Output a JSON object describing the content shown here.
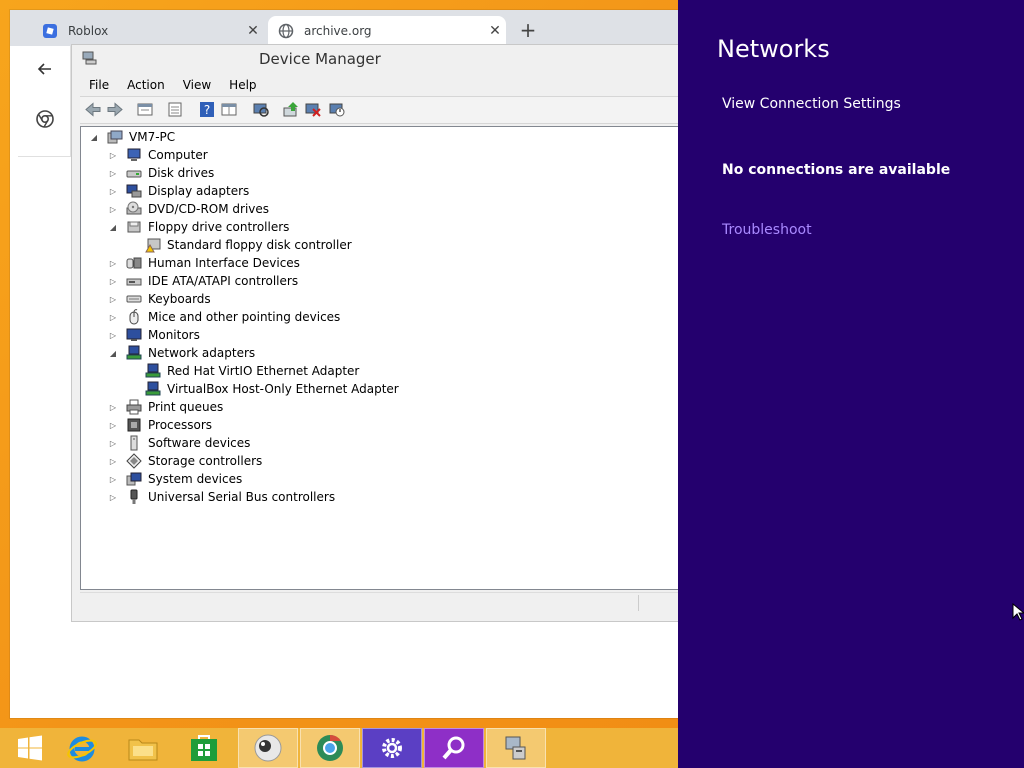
{
  "browser": {
    "tabs": [
      {
        "title": "Roblox",
        "favicon": "roblox-icon",
        "active": false
      },
      {
        "title": "archive.org",
        "favicon": "globe-icon",
        "active": true
      }
    ],
    "new_tab_symbol": "+",
    "close_symbol": "✕",
    "rail": [
      "back-arrow-icon",
      "chrome-icon"
    ]
  },
  "device_manager": {
    "title": "Device Manager",
    "menu": [
      "File",
      "Action",
      "View",
      "Help"
    ],
    "toolbar": [
      "back-icon",
      "forward-icon",
      "properties-icon",
      "show-hide-icon",
      "help-icon",
      "action-pane-icon",
      "scan-hardware-icon",
      "update-driver-icon",
      "uninstall-icon",
      "disable-icon"
    ],
    "tree": {
      "root": "VM7-PC",
      "nodes": [
        {
          "label": "Computer",
          "expanded": false,
          "icon": "computer-icon"
        },
        {
          "label": "Disk drives",
          "expanded": false,
          "icon": "disk-drive-icon"
        },
        {
          "label": "Display adapters",
          "expanded": false,
          "icon": "display-adapter-icon"
        },
        {
          "label": "DVD/CD-ROM drives",
          "expanded": false,
          "icon": "dvd-icon"
        },
        {
          "label": "Floppy drive controllers",
          "expanded": true,
          "icon": "floppy-controller-icon",
          "children": [
            {
              "label": "Standard floppy disk controller",
              "icon": "floppy-warning-icon"
            }
          ]
        },
        {
          "label": "Human Interface Devices",
          "expanded": false,
          "icon": "hid-icon"
        },
        {
          "label": "IDE ATA/ATAPI controllers",
          "expanded": false,
          "icon": "ide-icon"
        },
        {
          "label": "Keyboards",
          "expanded": false,
          "icon": "keyboard-icon"
        },
        {
          "label": "Mice and other pointing devices",
          "expanded": false,
          "icon": "mouse-icon"
        },
        {
          "label": "Monitors",
          "expanded": false,
          "icon": "monitor-icon"
        },
        {
          "label": "Network adapters",
          "expanded": true,
          "icon": "network-adapter-icon",
          "children": [
            {
              "label": "Red Hat VirtIO Ethernet Adapter",
              "icon": "network-adapter-icon"
            },
            {
              "label": "VirtualBox Host-Only Ethernet Adapter",
              "icon": "network-adapter-icon"
            }
          ]
        },
        {
          "label": "Print queues",
          "expanded": false,
          "icon": "printer-icon"
        },
        {
          "label": "Processors",
          "expanded": false,
          "icon": "processor-icon"
        },
        {
          "label": "Software devices",
          "expanded": false,
          "icon": "software-device-icon"
        },
        {
          "label": "Storage controllers",
          "expanded": false,
          "icon": "storage-controller-icon"
        },
        {
          "label": "System devices",
          "expanded": false,
          "icon": "system-device-icon"
        },
        {
          "label": "Universal Serial Bus controllers",
          "expanded": false,
          "icon": "usb-icon"
        }
      ]
    }
  },
  "networks_panel": {
    "title": "Networks",
    "view_settings": "View Connection Settings",
    "status": "No connections are available",
    "troubleshoot": "Troubleshoot"
  },
  "taskbar": {
    "items": [
      "start-icon",
      "internet-explorer-icon",
      "file-explorer-icon",
      "store-icon",
      "webcam-app-icon",
      "chrome-app-icon",
      "settings-icon",
      "search-app-icon",
      "device-manager-icon"
    ]
  },
  "colors": {
    "networks_bg": "#24006e",
    "troubleshoot_link": "#a989ff",
    "desktop": "#f39418"
  }
}
